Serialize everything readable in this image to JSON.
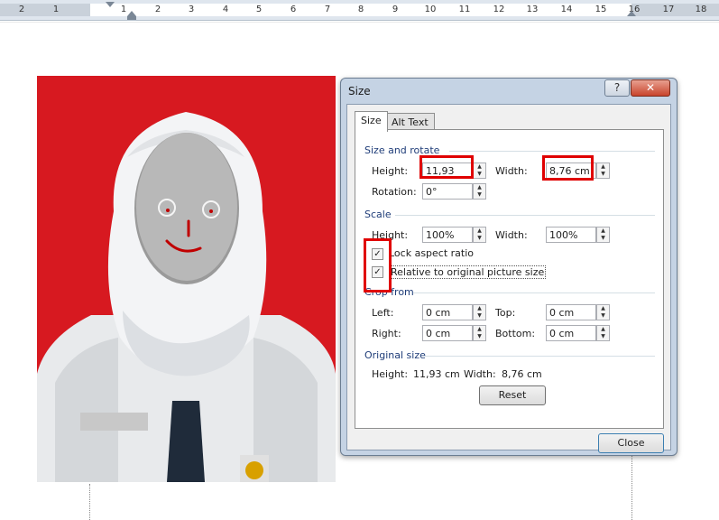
{
  "ruler": {
    "left_numbers": [
      "2",
      "1"
    ],
    "numbers": [
      "1",
      "2",
      "3",
      "4",
      "5",
      "6",
      "7",
      "8",
      "9",
      "10",
      "11",
      "12",
      "13",
      "14",
      "15",
      "16",
      "17",
      "18"
    ]
  },
  "dialog": {
    "title": "Size",
    "help_button": "?",
    "close_x": "✕",
    "tabs": [
      "Size",
      "Alt Text"
    ],
    "size_rotate": {
      "heading": "Size and rotate",
      "height_label": "Height:",
      "height_value": "11,93 cm",
      "width_label": "Width:",
      "width_value": "8,76 cm",
      "rotation_label": "Rotation:",
      "rotation_value": "0°"
    },
    "scale": {
      "heading": "Scale",
      "height_label": "Height:",
      "height_value": "100%",
      "width_label": "Width:",
      "width_value": "100%",
      "lock_label": "Lock aspect ratio",
      "lock_checked": true,
      "relative_label": "Relative to original picture size",
      "relative_checked": true
    },
    "crop": {
      "heading": "Crop from",
      "left_label": "Left:",
      "left_value": "0 cm",
      "top_label": "Top:",
      "top_value": "0 cm",
      "right_label": "Right:",
      "right_value": "0 cm",
      "bottom_label": "Bottom:",
      "bottom_value": "0 cm"
    },
    "original": {
      "heading": "Original size",
      "height_label": "Height:",
      "height_value": "11,93 cm",
      "width_label": "Width:",
      "width_value": "8,76 cm",
      "reset_label": "Reset"
    },
    "close_label": "Close"
  },
  "icons": {
    "spin_up": "▲",
    "spin_down": "▼",
    "check": "✓"
  },
  "colors": {
    "photo_background": "#d71920",
    "highlight": "#e00000",
    "dialog_frame": "#c5d3e4",
    "section_heading": "#1e3c78"
  }
}
